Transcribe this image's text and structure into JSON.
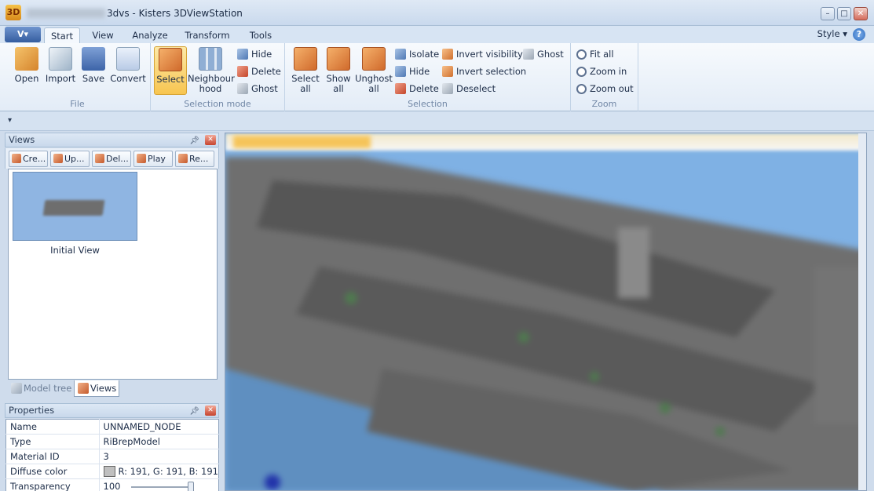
{
  "window": {
    "logo": "3D",
    "title": "3dvs - Kisters 3DViewStation",
    "title_obscured": true,
    "controls": [
      "–",
      "□",
      "✕"
    ]
  },
  "menu": {
    "app_button": "V▾",
    "tabs": [
      {
        "label": "Start",
        "active": true
      },
      {
        "label": "View",
        "active": false
      },
      {
        "label": "Analyze",
        "active": false
      },
      {
        "label": "Transform",
        "active": false
      },
      {
        "label": "Tools",
        "active": false
      }
    ],
    "style_label": "Style ▾",
    "help_icon": "?"
  },
  "ribbon": {
    "file": {
      "label": "File",
      "buttons": [
        "Open",
        "Import",
        "Save",
        "Convert"
      ]
    },
    "selection_mode": {
      "label": "Selection mode",
      "select": "Select",
      "neighbourhood": [
        "Neighbour",
        "hood"
      ],
      "small": [
        "Hide",
        "Delete",
        "Ghost"
      ]
    },
    "selection": {
      "label": "Selection",
      "select_all": [
        "Select",
        "all"
      ],
      "show_all": [
        "Show",
        "all"
      ],
      "unghost_all": [
        "Unghost",
        "all"
      ],
      "small_col1": [
        "Isolate",
        "Hide",
        "Delete"
      ],
      "small_col2": [
        "Invert visibility",
        "Invert selection",
        "Deselect"
      ],
      "small_col3": [
        "Ghost"
      ]
    },
    "zoom": {
      "label": "Zoom",
      "buttons": [
        "Fit all",
        "Zoom in",
        "Zoom out"
      ]
    }
  },
  "qat_icon": "▾",
  "views_panel": {
    "title": "Views",
    "toolbar": [
      "Cre...",
      "Up...",
      "Del...",
      "Play",
      "Re..."
    ],
    "thumbnail_label": "Initial View"
  },
  "bottom_tabs": [
    {
      "label": "Model tree",
      "active": false
    },
    {
      "label": "Views",
      "active": true
    }
  ],
  "properties_panel": {
    "title": "Properties",
    "rows": [
      {
        "key": "Name",
        "value": "UNNAMED_NODE"
      },
      {
        "key": "Type",
        "value": "RiBrepModel"
      },
      {
        "key": "Material ID",
        "value": "3"
      },
      {
        "key": "Diffuse color",
        "value": "R: 191, G: 191, B: 191",
        "swatch": "#bfbfbf"
      },
      {
        "key": "Transparency",
        "value": "100",
        "slider_level": 1.0
      }
    ]
  },
  "colors": {
    "accent_select": "#f7c550",
    "viewport_bg": "#7fb1e4",
    "model_gray": "#6e6e6e"
  }
}
